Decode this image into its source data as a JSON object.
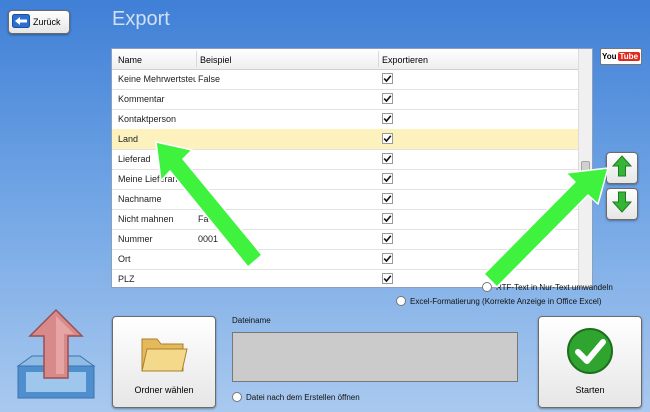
{
  "header": {
    "back_label": "Zurück",
    "title": "Export"
  },
  "grid": {
    "columns": [
      "Name",
      "Beispiel",
      "Exportieren"
    ],
    "rows": [
      {
        "name": "Keine Mehrwertsteu",
        "example": "False",
        "selected": false
      },
      {
        "name": "Kommentar",
        "example": "",
        "selected": false
      },
      {
        "name": "Kontaktperson",
        "example": "",
        "selected": false
      },
      {
        "name": "Land",
        "example": "",
        "selected": true
      },
      {
        "name": "Lieferad",
        "example": "",
        "selected": false
      },
      {
        "name": "Meine Lieferan",
        "example": "",
        "selected": false
      },
      {
        "name": "Nachname",
        "example": "",
        "selected": false
      },
      {
        "name": "Nicht mahnen",
        "example": "Fa",
        "selected": false
      },
      {
        "name": "Nummer",
        "example": "0001",
        "selected": false
      },
      {
        "name": "Ort",
        "example": "",
        "selected": false
      },
      {
        "name": "PLZ",
        "example": "",
        "selected": false
      }
    ]
  },
  "youtube": {
    "you": "You",
    "tube": "Tube"
  },
  "options": {
    "rtf_label": "RTF-Text in Nur-Text umwandeln",
    "excel_label": "Excel-Formatierung (Korrekte Anzeige in Office Excel)",
    "open_after_label": "Datei nach dem Erstellen öffnen"
  },
  "folder": {
    "label": "Ordner wählen"
  },
  "filename": {
    "label": "Dateiname",
    "value": ""
  },
  "start": {
    "label": "Starten"
  },
  "colors": {
    "selected_row": "#fdf1bd",
    "annotation_arrow": "#3ef23e",
    "check_green": "#2fa52f"
  }
}
